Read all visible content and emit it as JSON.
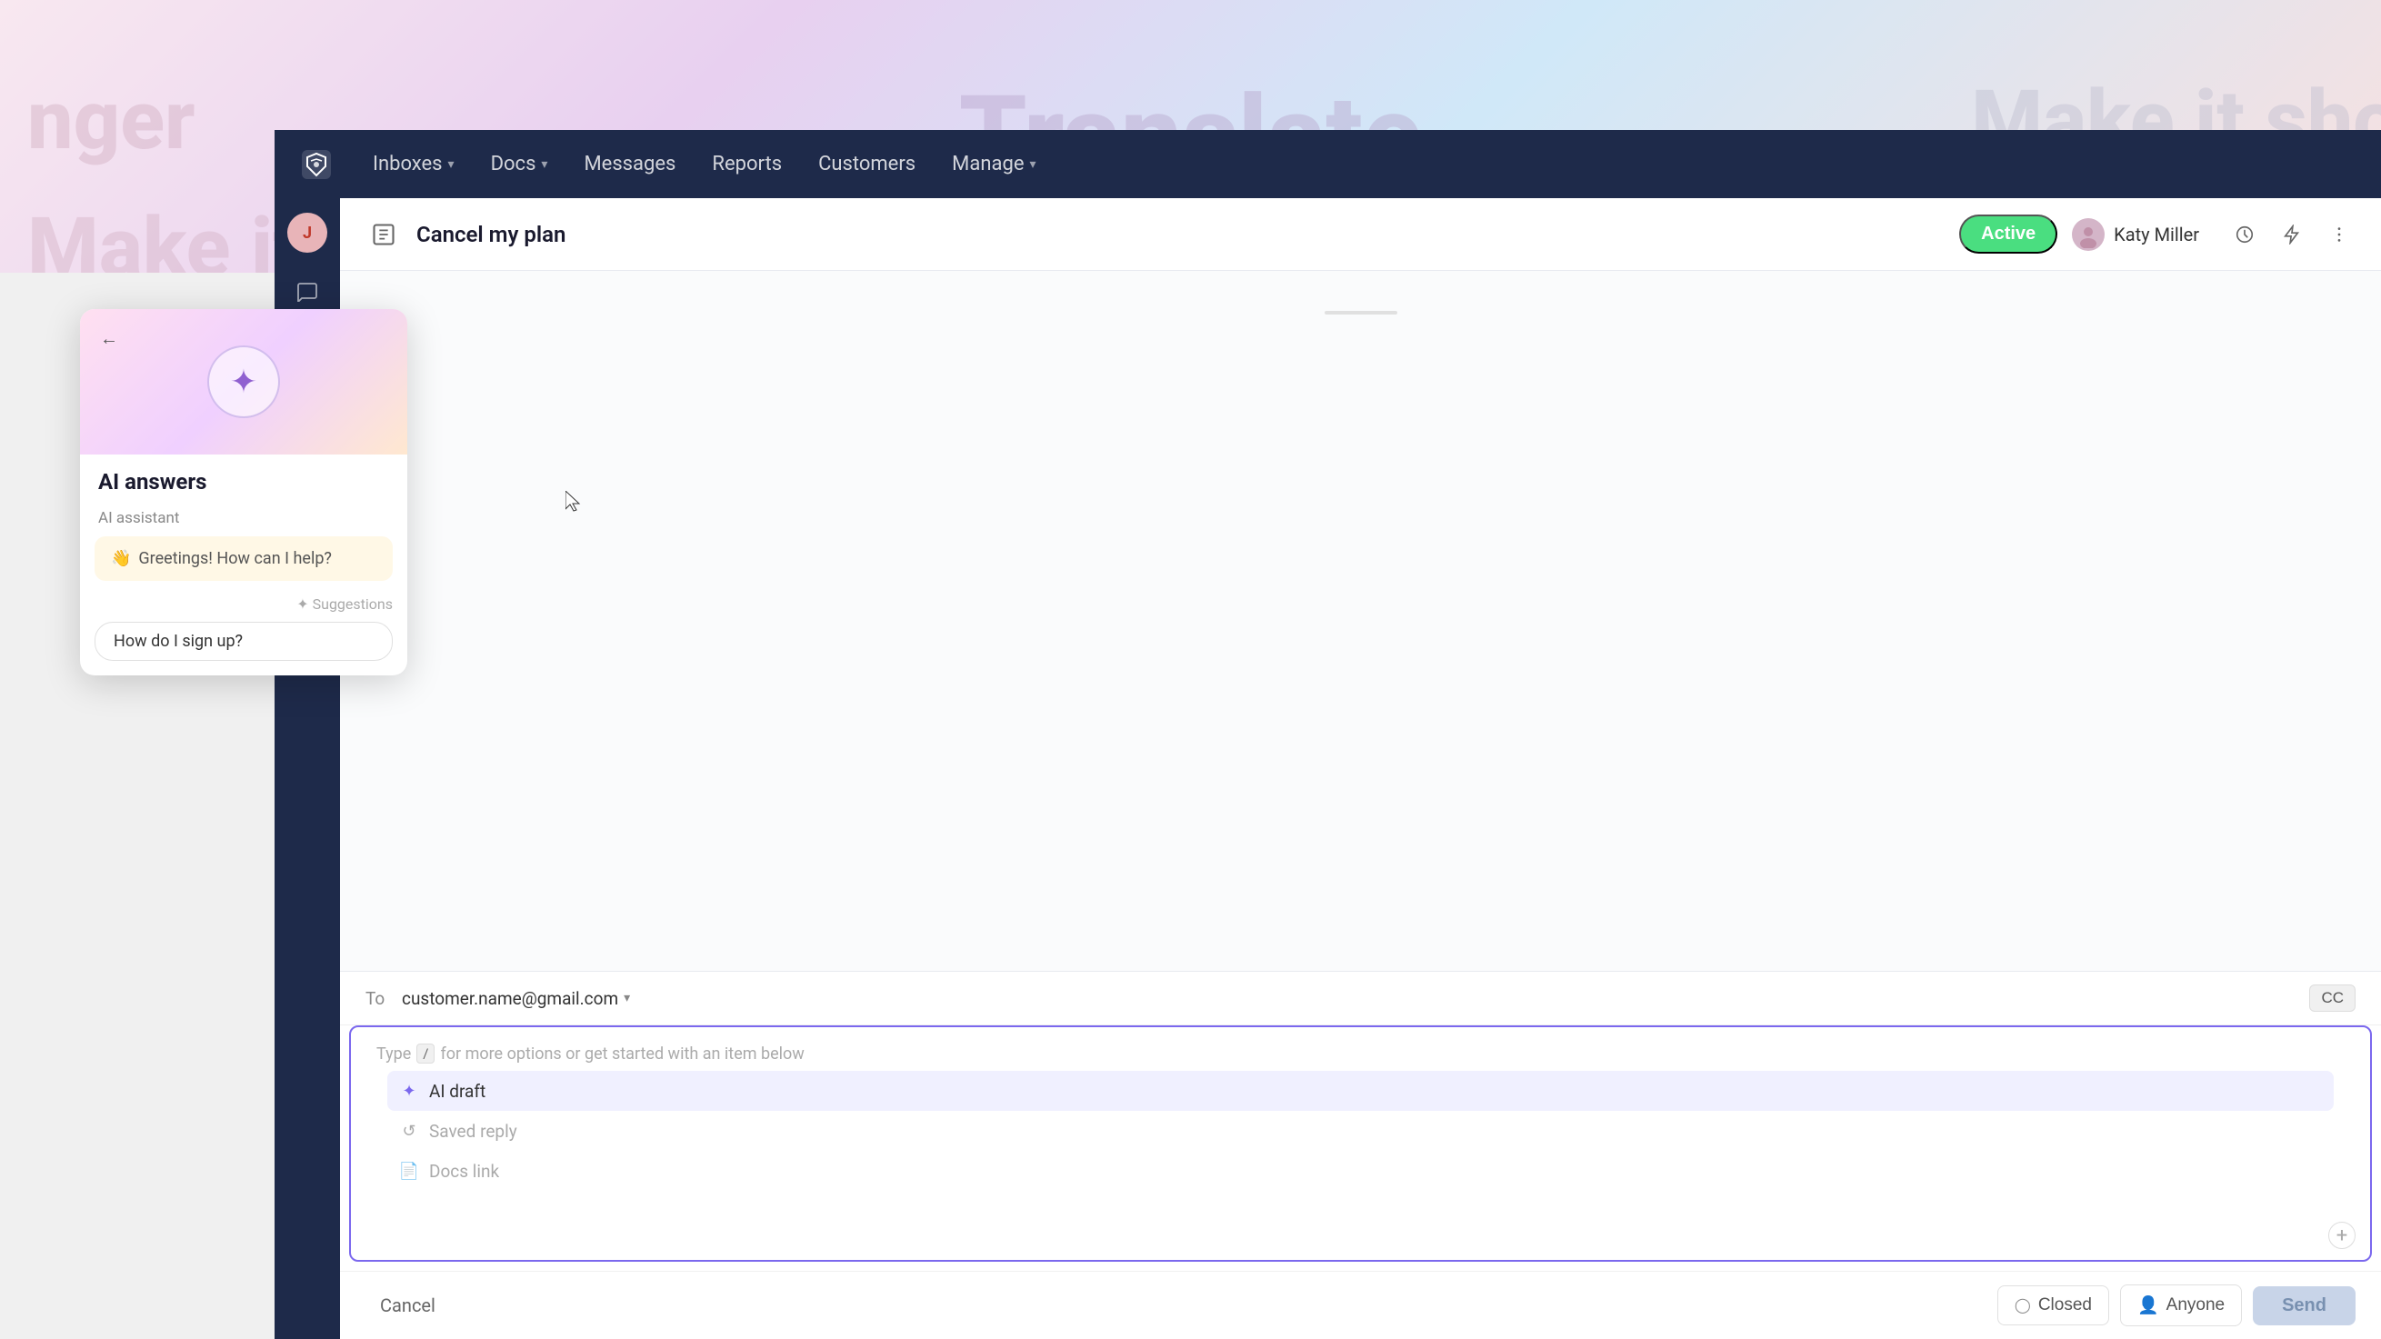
{
  "background": {
    "text1": "Translate",
    "text_left": "nger",
    "text_right": "Make it sho",
    "text_bottom_left": "Make it m"
  },
  "navbar": {
    "logo_alt": "Chatwoot logo",
    "items": [
      {
        "label": "Inboxes",
        "has_dropdown": true
      },
      {
        "label": "Docs",
        "has_dropdown": true
      },
      {
        "label": "Messages",
        "has_dropdown": false
      },
      {
        "label": "Reports",
        "has_dropdown": false
      },
      {
        "label": "Customers",
        "has_dropdown": false
      },
      {
        "label": "Manage",
        "has_dropdown": true
      }
    ]
  },
  "sidebar": {
    "avatar_label": "J",
    "icons": [
      "chat-bubble",
      "inbox"
    ]
  },
  "conversation": {
    "icon": "compose",
    "title": "Cancel my plan",
    "status": "Active",
    "agent_name": "Katy Miller"
  },
  "email_compose": {
    "to_label": "To",
    "to_address": "customer.name@gmail.com",
    "cc_label": "CC",
    "placeholder_text": "Type",
    "slash_hint": "/",
    "placeholder_suffix": "for more options or get started with an item below",
    "quick_actions": [
      {
        "label": "AI draft",
        "icon": "sparkle",
        "muted": false
      },
      {
        "label": "Saved reply",
        "icon": "refresh",
        "muted": true
      },
      {
        "label": "Docs link",
        "icon": "doc",
        "muted": true
      }
    ],
    "cancel_label": "Cancel",
    "status_btn_label": "Closed",
    "assignee_label": "Anyone",
    "send_label": "Send"
  },
  "ai_panel": {
    "back_icon": "←",
    "sparkle_icon": "✦",
    "title": "AI answers",
    "assistant_label": "AI assistant",
    "greeting_emoji": "👋",
    "greeting_text": "Greetings! How can I help?",
    "suggestions_label": "Suggestions",
    "suggestion_text": "How do I sign up?"
  }
}
